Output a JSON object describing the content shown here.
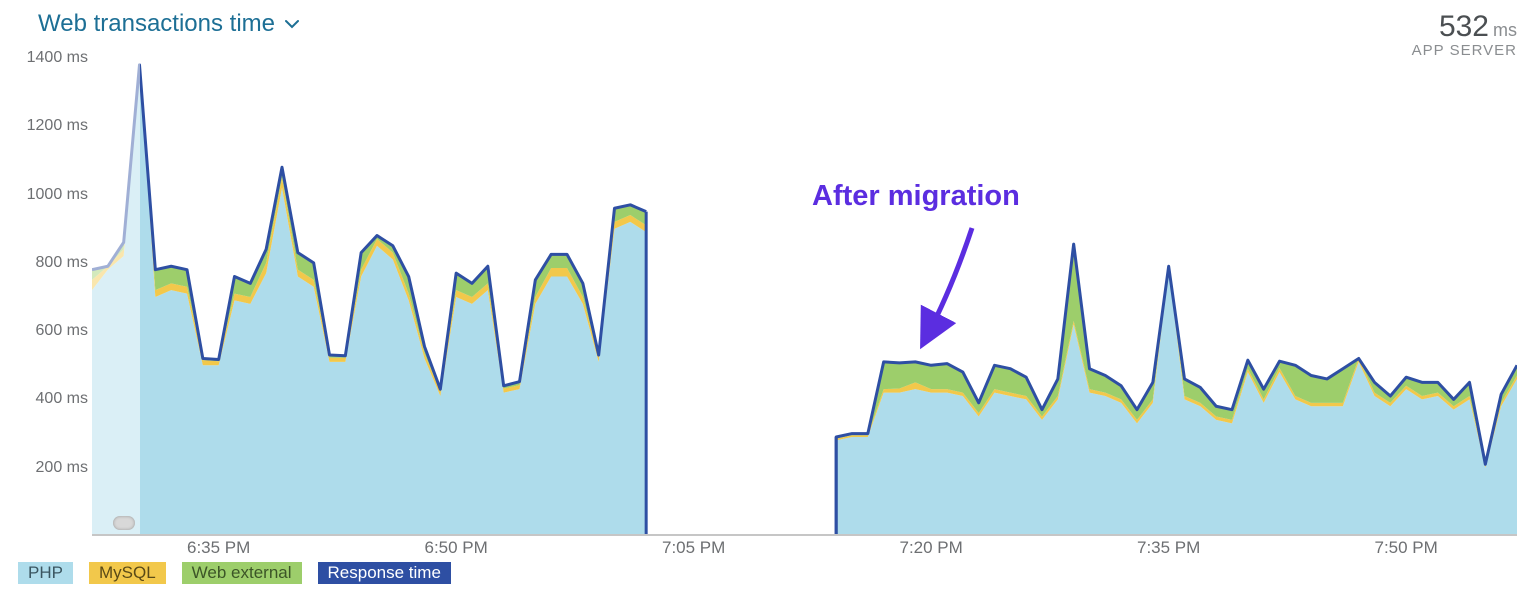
{
  "header": {
    "title": "Web transactions time",
    "stat_value": "532",
    "stat_unit": "ms",
    "stat_label": "APP SERVER"
  },
  "annotation": {
    "text": "After migration"
  },
  "legend": [
    {
      "name": "PHP",
      "bg": "#aedceb",
      "fg": "#3a5560"
    },
    {
      "name": "MySQL",
      "bg": "#f2c84b",
      "fg": "#5a4a17"
    },
    {
      "name": "Web external",
      "bg": "#9dce6b",
      "fg": "#3c5527"
    },
    {
      "name": "Response time",
      "bg": "#2e4fa3",
      "fg": "#ffffff"
    }
  ],
  "colors": {
    "php": "#aedceb",
    "mysql": "#f2c84b",
    "web_external": "#9dce6b",
    "response_time_line": "#2e4fa3",
    "annotation": "#5b2de0"
  },
  "chart_data": {
    "type": "area",
    "title": "Web transactions time",
    "xlabel": "",
    "ylabel": "",
    "yunit": "ms",
    "ylim": [
      0,
      1400
    ],
    "y_ticks": [
      200,
      400,
      600,
      800,
      1000,
      1200,
      1400
    ],
    "x_ticks": [
      "6:35 PM",
      "6:50 PM",
      "7:05 PM",
      "7:20 PM",
      "7:35 PM",
      "7:50 PM"
    ],
    "x_start": "6:27 PM",
    "x_end": "7:57 PM",
    "sample_interval_minutes": 1,
    "x": [
      "6:27",
      "6:28",
      "6:29",
      "6:30",
      "6:31",
      "6:32",
      "6:33",
      "6:34",
      "6:35",
      "6:36",
      "6:37",
      "6:38",
      "6:39",
      "6:40",
      "6:41",
      "6:42",
      "6:43",
      "6:44",
      "6:45",
      "6:46",
      "6:47",
      "6:48",
      "6:49",
      "6:50",
      "6:51",
      "6:52",
      "6:53",
      "6:54",
      "6:55",
      "6:56",
      "6:57",
      "6:58",
      "6:59",
      "7:00",
      "7:01",
      "7:02",
      "7:03",
      "7:04",
      "7:05",
      "7:06",
      "7:07",
      "7:08",
      "7:09",
      "7:10",
      "7:11",
      "7:12",
      "7:13",
      "7:14",
      "7:15",
      "7:16",
      "7:17",
      "7:18",
      "7:19",
      "7:20",
      "7:21",
      "7:22",
      "7:23",
      "7:24",
      "7:25",
      "7:26",
      "7:27",
      "7:28",
      "7:29",
      "7:30",
      "7:31",
      "7:32",
      "7:33",
      "7:34",
      "7:35",
      "7:36",
      "7:37",
      "7:38",
      "7:39",
      "7:40",
      "7:41",
      "7:42",
      "7:43",
      "7:44",
      "7:45",
      "7:46",
      "7:47",
      "7:48",
      "7:49",
      "7:50",
      "7:51",
      "7:52",
      "7:53",
      "7:54",
      "7:55",
      "7:56",
      "7:57"
    ],
    "series": [
      {
        "name": "PHP",
        "color": "#aedceb",
        "values": [
          720,
          780,
          820,
          1380,
          700,
          720,
          710,
          500,
          500,
          690,
          680,
          770,
          1020,
          760,
          730,
          510,
          510,
          760,
          850,
          810,
          690,
          520,
          410,
          700,
          680,
          720,
          420,
          430,
          680,
          760,
          760,
          680,
          510,
          900,
          920,
          890,
          0,
          0,
          0,
          0,
          0,
          0,
          0,
          0,
          0,
          0,
          0,
          280,
          290,
          290,
          420,
          420,
          430,
          420,
          420,
          410,
          350,
          420,
          410,
          400,
          340,
          400,
          620,
          420,
          410,
          390,
          330,
          390,
          780,
          400,
          380,
          340,
          330,
          480,
          390,
          480,
          400,
          380,
          380,
          380,
          510,
          410,
          380,
          430,
          400,
          410,
          370,
          400,
          200,
          380,
          460
        ]
      },
      {
        "name": "MySQL",
        "color": "#f2c84b",
        "values": [
          30,
          10,
          20,
          0,
          20,
          20,
          20,
          15,
          12,
          20,
          20,
          30,
          30,
          20,
          20,
          12,
          12,
          20,
          20,
          20,
          20,
          15,
          12,
          20,
          20,
          20,
          12,
          12,
          20,
          25,
          25,
          20,
          15,
          20,
          20,
          20,
          0,
          0,
          0,
          0,
          0,
          0,
          0,
          0,
          0,
          0,
          0,
          5,
          5,
          5,
          10,
          12,
          20,
          10,
          10,
          10,
          10,
          10,
          10,
          10,
          10,
          10,
          10,
          10,
          10,
          10,
          10,
          10,
          10,
          10,
          10,
          10,
          10,
          10,
          10,
          12,
          10,
          10,
          10,
          10,
          10,
          10,
          10,
          10,
          10,
          10,
          10,
          10,
          5,
          10,
          10
        ]
      },
      {
        "name": "Web external",
        "color": "#9dce6b",
        "values": [
          30,
          0,
          20,
          0,
          60,
          50,
          50,
          5,
          5,
          50,
          40,
          40,
          30,
          50,
          50,
          8,
          6,
          50,
          10,
          20,
          50,
          20,
          8,
          50,
          40,
          50,
          8,
          10,
          50,
          40,
          40,
          40,
          5,
          40,
          30,
          40,
          0,
          0,
          0,
          0,
          0,
          0,
          0,
          0,
          0,
          0,
          0,
          5,
          5,
          5,
          80,
          75,
          60,
          70,
          75,
          60,
          30,
          70,
          70,
          55,
          20,
          50,
          225,
          60,
          50,
          40,
          30,
          50,
          0,
          50,
          45,
          30,
          30,
          25,
          30,
          20,
          90,
          80,
          70,
          100,
          0,
          30,
          20,
          25,
          40,
          30,
          20,
          40,
          5,
          25,
          30
        ]
      }
    ],
    "total_line_name": "Response time",
    "gap_range": [
      "7:03",
      "7:13"
    ],
    "faded_range": [
      "6:27",
      "6:30"
    ]
  }
}
